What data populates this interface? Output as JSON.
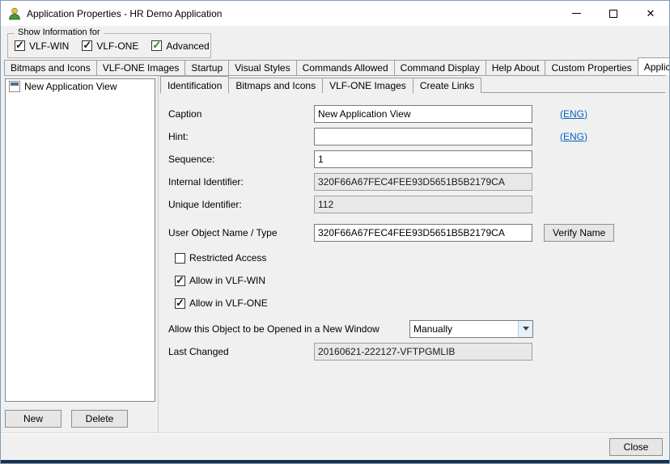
{
  "window": {
    "title": "Application Properties - HR Demo Application"
  },
  "show_info": {
    "legend": "Show Information for",
    "checkboxes": [
      {
        "label": "VLF-WIN",
        "checked": true
      },
      {
        "label": "VLF-ONE",
        "checked": true
      },
      {
        "label": "Advanced",
        "checked": true,
        "check_color": "#2f7d32"
      }
    ]
  },
  "main_tabs": {
    "items": [
      "Bitmaps and Icons",
      "VLF-ONE Images",
      "Startup",
      "Visual Styles",
      "Commands Allowed",
      "Command Display",
      "Help About",
      "Custom Properties",
      "Application Views"
    ],
    "active": "Application Views",
    "scroll_left": "‹",
    "scroll_right": "›"
  },
  "left_panel": {
    "items": [
      {
        "label": "New Application View"
      }
    ],
    "new_button": "New",
    "delete_button": "Delete"
  },
  "detail_tabs": {
    "items": [
      "Identification",
      "Bitmaps and Icons",
      "VLF-ONE Images",
      "Create Links"
    ],
    "active": "Identification"
  },
  "form": {
    "caption": {
      "label": "Caption",
      "value": "New Application View",
      "lang": "(ENG)"
    },
    "hint": {
      "label": "Hint:",
      "value": "",
      "lang": "(ENG)"
    },
    "sequence": {
      "label": "Sequence:",
      "value": "1"
    },
    "internal_id": {
      "label": "Internal Identifier:",
      "value": "320F66A67FEC4FEE93D5651B5B2179CA"
    },
    "unique_id": {
      "label": "Unique Identifier:",
      "value": "112"
    },
    "user_object": {
      "label": "User Object Name / Type",
      "value": "320F66A67FEC4FEE93D5651B5B2179CA",
      "button": "Verify Name"
    },
    "restricted": {
      "label": "Restricted Access",
      "checked": false
    },
    "allow_win": {
      "label": "Allow in VLF-WIN",
      "checked": true
    },
    "allow_one": {
      "label": "Allow in VLF-ONE",
      "checked": true
    },
    "open_window": {
      "label": "Allow this Object to be Opened in a New Window",
      "value": "Manually"
    },
    "last_changed": {
      "label": "Last Changed",
      "value": "20160621-222127-VFTPGMLIB"
    }
  },
  "footer": {
    "close": "Close"
  },
  "colors": {
    "link": "#0563c1",
    "titlebar": "#ffffff",
    "dialog_bg": "#f0f0f0",
    "readonly_bg": "#e8e8e8",
    "advanced_check": "#2f7d32"
  }
}
